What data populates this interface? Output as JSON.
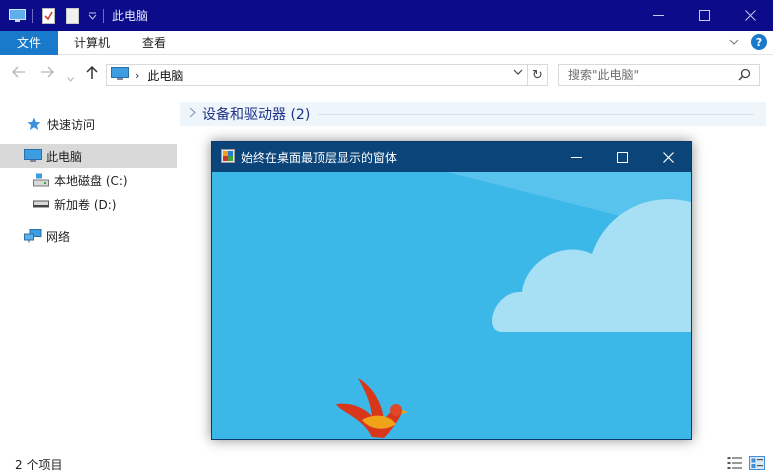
{
  "titlebar": {
    "title": "此电脑",
    "minimize_icon": "minimize-icon",
    "maximize_icon": "maximize-icon",
    "close_icon": "close-icon"
  },
  "ribbon": {
    "tabs": [
      {
        "label": "文件"
      },
      {
        "label": "计算机"
      },
      {
        "label": "查看"
      }
    ],
    "expand_icon": "chevron-down-icon",
    "help_label": "?"
  },
  "address": {
    "path": "此电脑",
    "search_placeholder": "搜索\"此电脑\""
  },
  "sidebar": {
    "items": [
      {
        "label": "快速访问",
        "icon": "star-icon"
      },
      {
        "label": "此电脑",
        "icon": "computer-icon"
      },
      {
        "label": "本地磁盘 (C:)",
        "icon": "drive-c-icon"
      },
      {
        "label": "新加卷 (D:)",
        "icon": "drive-icon"
      },
      {
        "label": "网络",
        "icon": "network-icon"
      }
    ]
  },
  "main": {
    "group_label": "设备和驱动器 (2)"
  },
  "status": {
    "count": "2 个项目"
  },
  "float_window": {
    "title": "始终在桌面最顶层显示的窗体"
  },
  "colors": {
    "titlebar": "#0c0c8a",
    "accent": "#1979ca",
    "float_titlebar": "#0a4479",
    "sky": "#3bb8e8"
  }
}
